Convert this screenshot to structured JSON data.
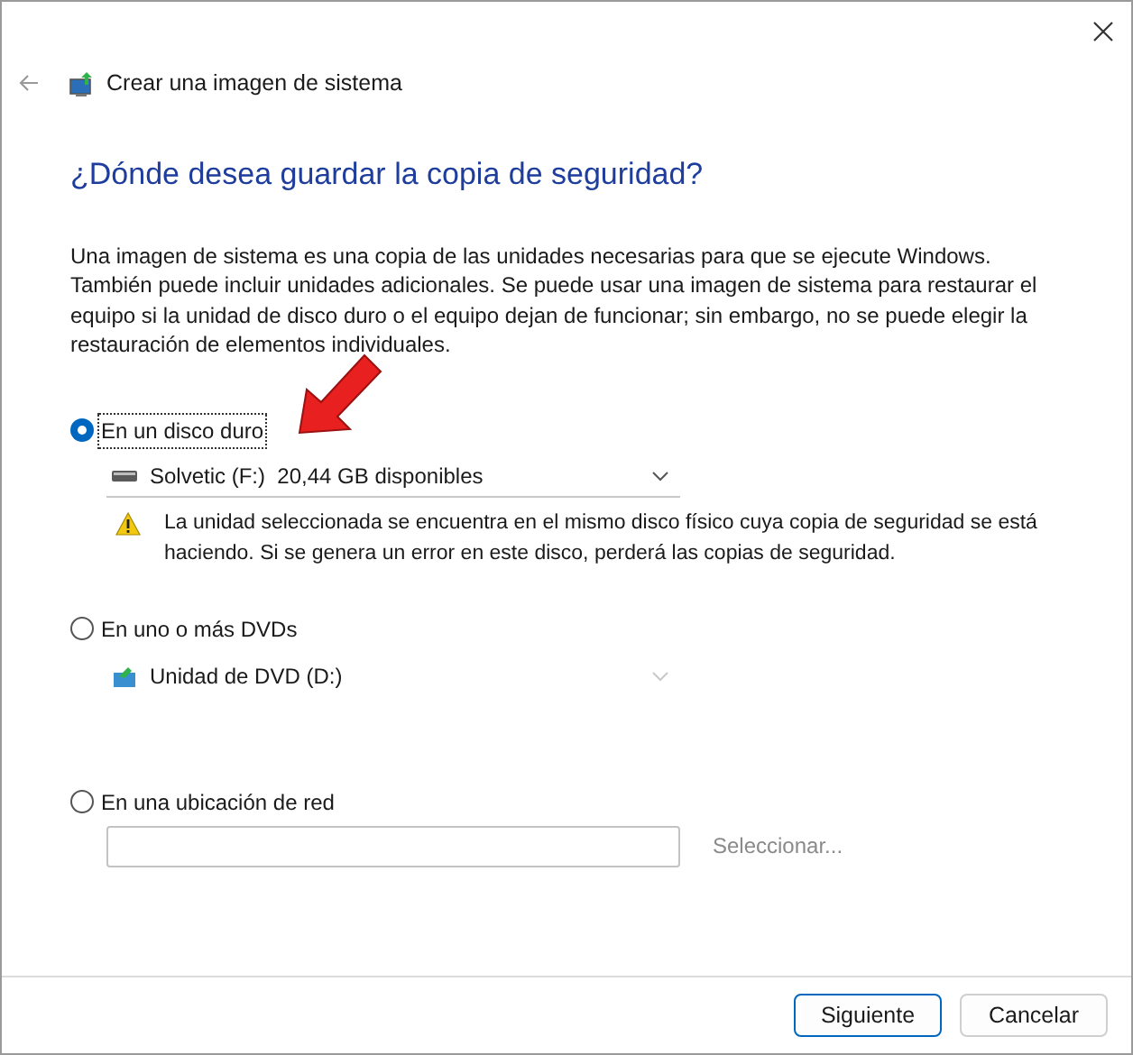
{
  "window": {
    "title": "Crear una imagen de sistema"
  },
  "heading": "¿Dónde desea guardar la copia de seguridad?",
  "description": "Una imagen de sistema es una copia de las unidades necesarias para que se ejecute Windows. También puede incluir unidades adicionales. Se puede usar una imagen de sistema para restaurar el equipo si la unidad de disco duro o el equipo dejan de funcionar; sin embargo, no se puede elegir la restauración de elementos individuales.",
  "options": [
    {
      "kind": "drive",
      "label": "En un disco duro",
      "selected": true,
      "dropdown": {
        "value": "Solvetic (F:)  20,44 GB disponibles",
        "disabled": false
      },
      "warning": "La unidad seleccionada se encuentra en el mismo disco físico cuya copia de seguridad se está haciendo. Si se genera un error en este disco, perderá las copias de seguridad."
    },
    {
      "kind": "dvd",
      "label": "En uno o más DVDs",
      "selected": false,
      "dropdown": {
        "value": "Unidad de DVD (D:)",
        "disabled": true
      }
    },
    {
      "kind": "network",
      "label": "En una ubicación de red",
      "selected": false,
      "browse": {
        "label": "Seleccionar...",
        "disabled": true
      }
    }
  ],
  "buttons": [
    {
      "label": "Siguiente",
      "default": true
    },
    {
      "label": "Cancelar",
      "default": false
    }
  ]
}
